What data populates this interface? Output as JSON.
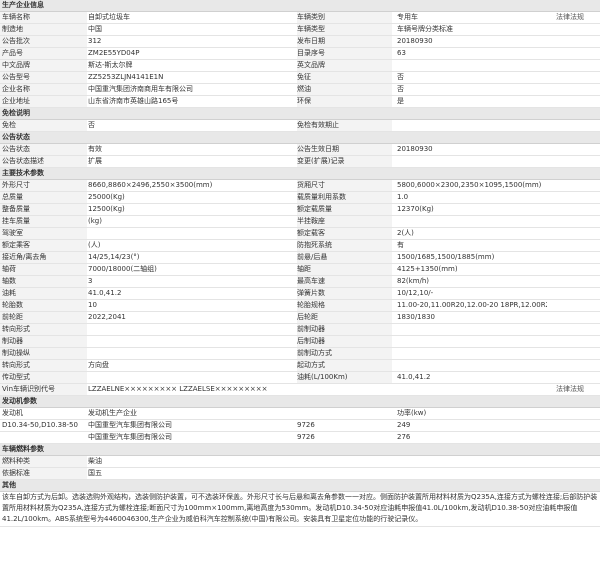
{
  "sections": {
    "basic": "生产企业信息",
    "exempt": "免检说明",
    "status": "公告状态",
    "tech": "主要技术参数",
    "engine": "发动机参数",
    "fuel": "车辆燃料参数",
    "other": "其他"
  },
  "basic": [
    [
      "车辆名称",
      "自卸式垃圾车",
      "车辆类别",
      "专用车",
      "法律法规"
    ],
    [
      "制造地",
      "中国",
      "车辆类型",
      "车辆号牌分类标准",
      ""
    ],
    [
      "公告批次",
      "312",
      "发布日期",
      "20180930",
      ""
    ],
    [
      "产品号",
      "ZM2E55YD04P",
      "目录序号",
      "63",
      ""
    ],
    [
      "中文品牌",
      "斯达-斯太尔牌",
      "英文品牌",
      "",
      ""
    ],
    [
      "公告型号",
      "ZZ5253ZLJN4141E1N",
      "免征",
      "否",
      ""
    ],
    [
      "企业名称",
      "中国重汽集团济南商用车有限公司",
      "燃油",
      "否",
      ""
    ],
    [
      "企业地址",
      "山东省济南市英雄山路165号",
      "环保",
      "是",
      ""
    ]
  ],
  "exempt": [
    [
      "免检",
      "否",
      "免检有效期止",
      ""
    ]
  ],
  "status": [
    [
      "公告状态",
      "有效",
      "公告生效日期",
      "20180930"
    ],
    [
      "公告状态描述",
      "扩展",
      "变更(扩展)记录",
      ""
    ]
  ],
  "tech": [
    [
      "外形尺寸",
      "8660,8860×2496,2550×3500(mm)",
      "货厢尺寸",
      "5800,6000×2300,2350×1095,1500(mm)"
    ],
    [
      "总质量",
      "25000(Kg)",
      "载质量利用系数",
      "1.0"
    ],
    [
      "整备质量",
      "12500(Kg)",
      "额定载质量",
      "12370(Kg)"
    ],
    [
      "挂车质量",
      "(kg)",
      "半挂鞍座",
      ""
    ],
    [
      "驾驶室",
      "",
      "额定载客",
      "2(人)"
    ],
    [
      "额定乘客",
      "(人)",
      "防抱死系统",
      "有"
    ],
    [
      "接近角/离去角",
      "14/25,14/23(°)",
      "前悬/后悬",
      "1500/1685,1500/1885(mm)"
    ],
    [
      "轴荷",
      "7000/18000(二轴组)",
      "轴距",
      "4125+1350(mm)"
    ],
    [
      "轴数",
      "3",
      "最高车速",
      "82(km/h)"
    ],
    [
      "油耗",
      "41.0,41.2",
      "弹簧片数",
      "10/12,10/-"
    ],
    [
      "轮胎数",
      "10",
      "轮胎规格",
      "11.00-20,11.00R20,12.00-20 18PR,12.00R20 16PR"
    ],
    [
      "前轮距",
      "2022,2041",
      "后轮距",
      "1830/1830"
    ],
    [
      "转向形式",
      "",
      "前制动器",
      ""
    ],
    [
      "制动器",
      "",
      "后制动器",
      ""
    ],
    [
      "制动操纵",
      "",
      "前制动方式",
      ""
    ],
    [
      "转向形式",
      "方向盘",
      "起动方式",
      ""
    ],
    [
      "传动型式",
      "",
      "油耗(L/100Km)",
      "41.0,41.2"
    ]
  ],
  "vin": {
    "label": "Vin车辆识别代号",
    "value": "LZZAELNE×××××××××  LZZAELSE×××××××××",
    "law": "法律法规"
  },
  "engine": {
    "header": [
      "发动机",
      "发动机生产企业",
      "功率(kw)"
    ],
    "rows": [
      [
        "D10.34-50,D10.38-50",
        "中国重型汽车集团有限公司",
        "9726",
        "249"
      ],
      [
        "",
        "中国重型汽车集团有限公司",
        "9726",
        "276"
      ]
    ]
  },
  "fuel": [
    [
      "燃料种类",
      "柴油"
    ],
    [
      "依据标准",
      "国五"
    ]
  ],
  "other_text": "该车自卸方式为后卸。选装选购外观结构，选装侧防护装置，可不选装环保盖。外形尺寸长与后悬和离去角参数一一对应。侧面防护装置所用材料材质为Q235A,连接方式为螺栓连接;后部防护装置所用材料材质为Q235A,连接方式为螺栓连接;断面尺寸为100mm×100mm,离地高度为530mm。发动机D10.34-50对应油耗申报值41.0L/100km,发动机D10.38-50对应油耗申报值41.2L/100km。ABS系统型号为4460046300,生产企业为威伯科汽车控制系统(中国)有限公司。安装具有卫星定位功能的行驶记录仪。"
}
